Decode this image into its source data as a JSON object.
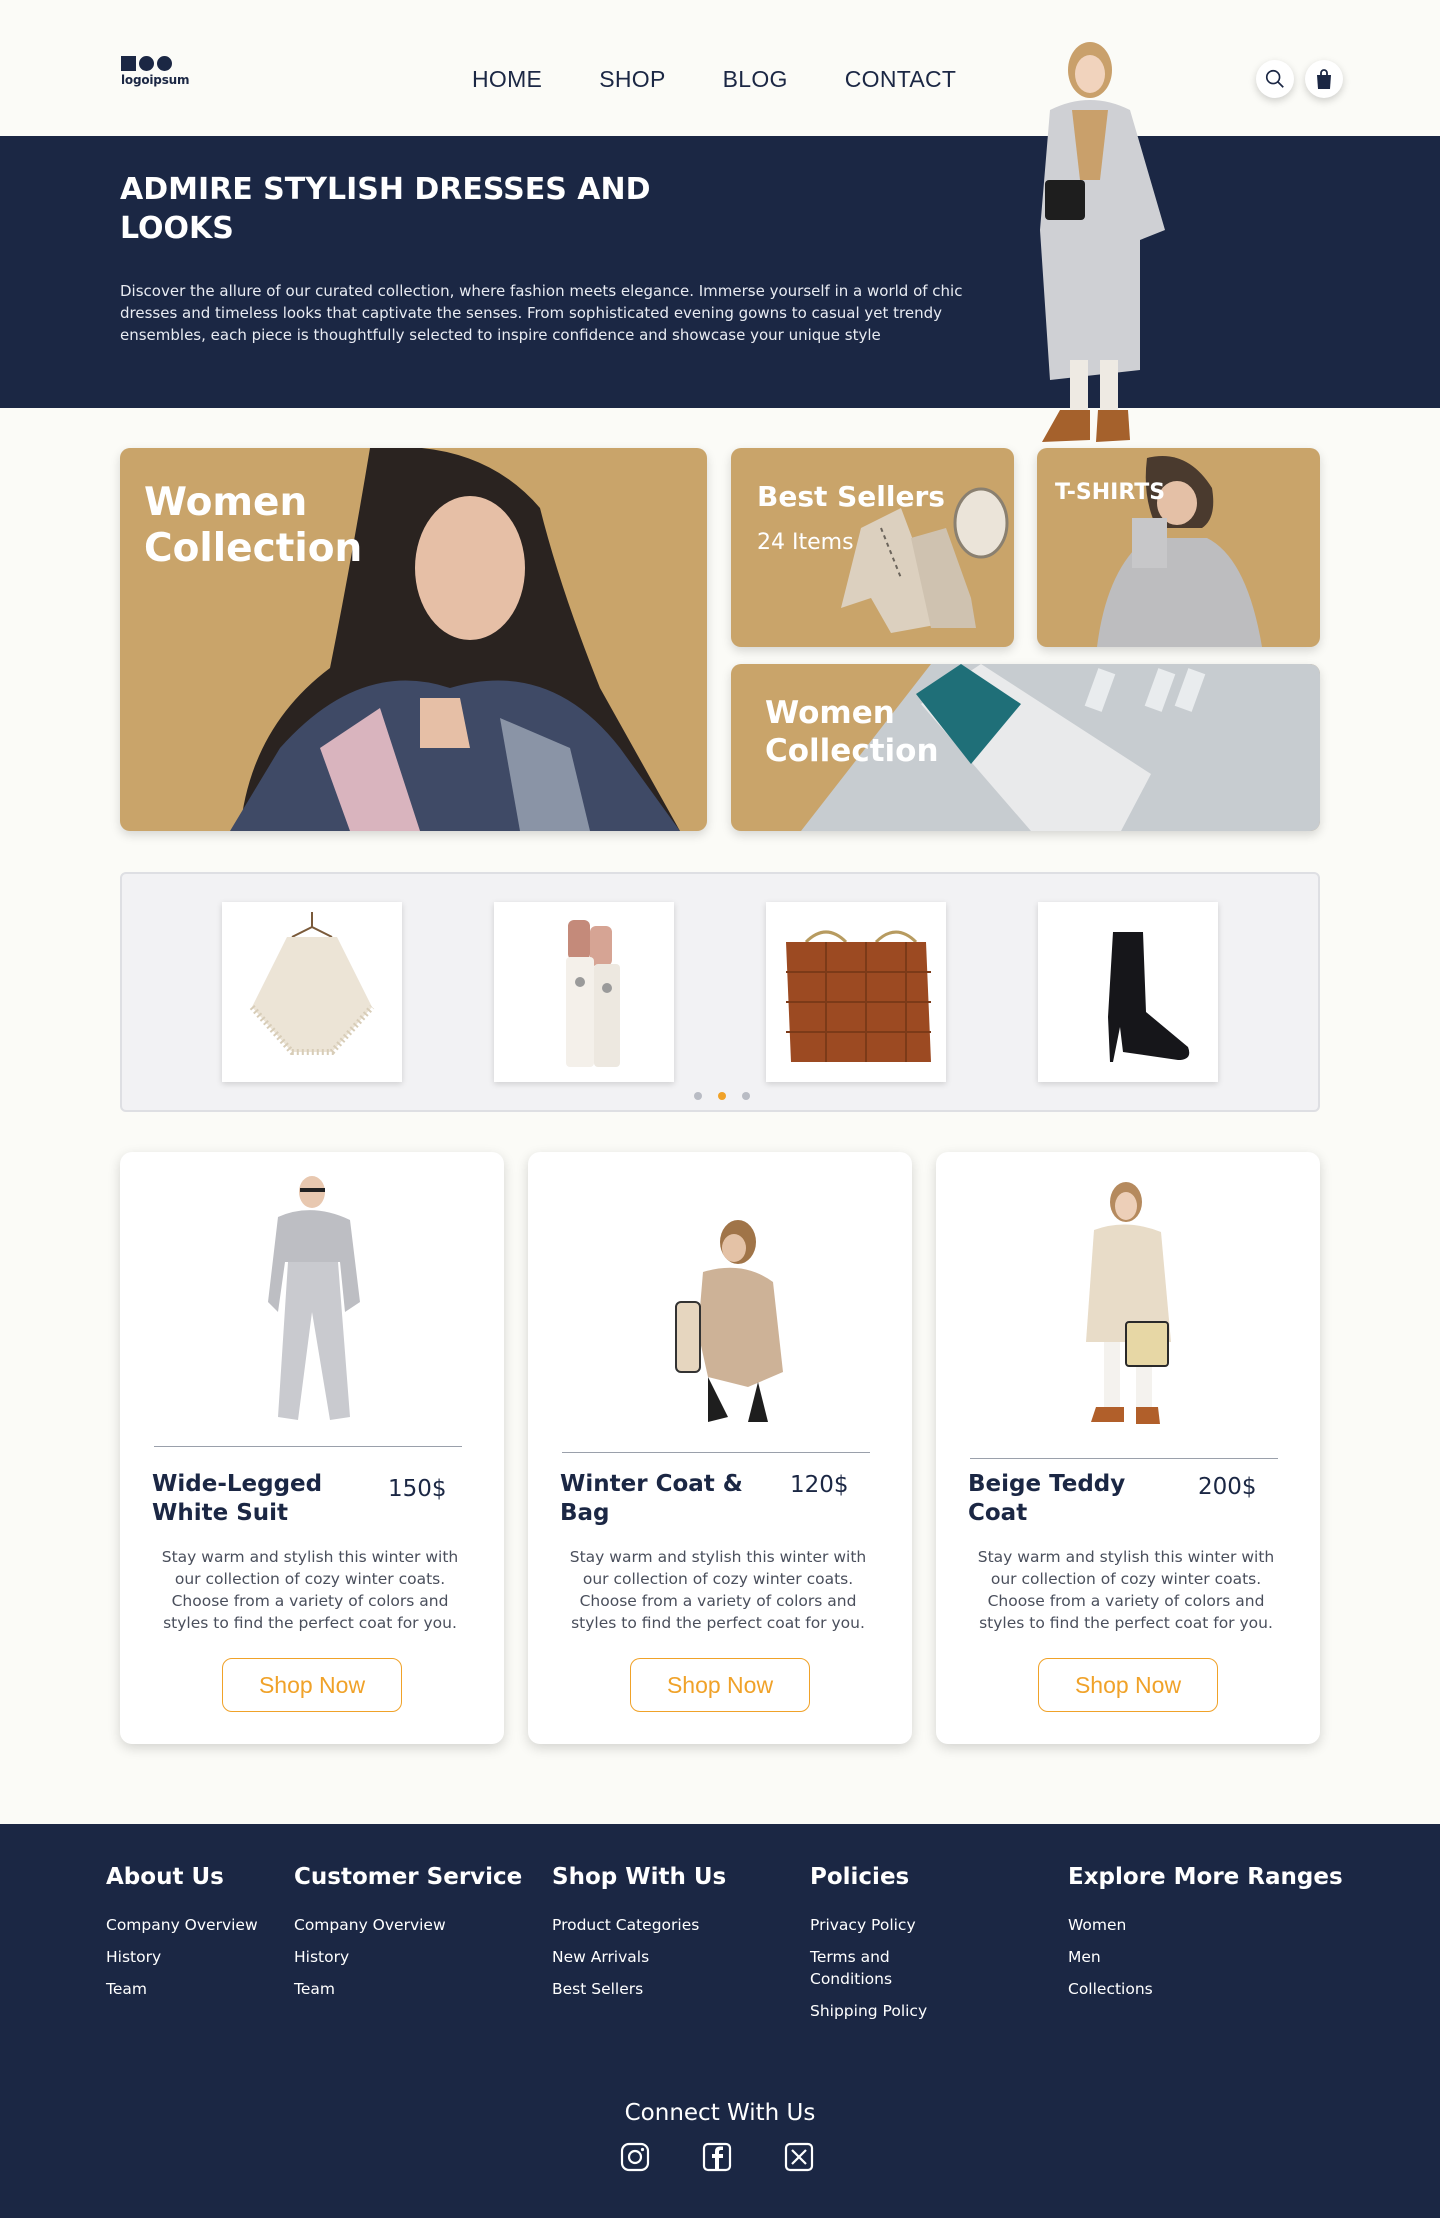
{
  "header": {
    "logo_text": "logoipsum",
    "nav": [
      "HOME",
      "SHOP",
      "BLOG",
      "CONTACT"
    ],
    "search_icon": "search-icon",
    "cart_icon": "shopping-bag-icon"
  },
  "hero": {
    "title": "ADMIRE STYLISH DRESSES AND LOOKS",
    "description": "Discover the allure of our curated collection, where fashion meets elegance. Immerse yourself in a world of chic dresses and timeless looks that captivate the senses. From sophisticated evening gowns to casual yet trendy ensembles, each piece is thoughtfully selected to inspire confidence and showcase your unique style"
  },
  "collections": {
    "women": "Women Collection",
    "best_sellers": "Best Sellers",
    "best_sellers_count": "24 Items",
    "tshirts": "T-SHIRTS",
    "women2": "Women Collection"
  },
  "carousel": {
    "items": [
      "poncho",
      "cosmetic bottles",
      "brown woven bag",
      "black ankle boot"
    ],
    "active_dot": 1
  },
  "products": [
    {
      "name": "Wide-Legged White Suit",
      "price": "150$",
      "description": "Stay warm and stylish this winter with our collection of cozy winter coats. Choose from a variety of colors and styles to find the perfect coat for you.",
      "button": "Shop Now"
    },
    {
      "name": "Winter Coat & Bag",
      "price": "120$",
      "description": "Stay warm and stylish this winter with our collection of cozy winter coats. Choose from a variety of colors and styles to find the perfect coat for you.",
      "button": "Shop Now"
    },
    {
      "name": "Beige Teddy Coat",
      "price": "200$",
      "description": "Stay warm and stylish this winter with our collection of cozy winter coats. Choose from a variety of colors and styles to find the perfect coat for you.",
      "button": "Shop Now"
    }
  ],
  "footer": {
    "columns": [
      {
        "title": "About Us",
        "links": [
          "Company Overview",
          "History",
          "Team"
        ]
      },
      {
        "title": "Customer Service",
        "links": [
          "Company Overview",
          "History",
          "Team"
        ]
      },
      {
        "title": "Shop With Us",
        "links": [
          "Product Categories",
          "New Arrivals",
          "Best Sellers"
        ]
      },
      {
        "title": "Policies",
        "links": [
          "Privacy Policy",
          "Terms and Conditions",
          "Shipping Policy"
        ]
      },
      {
        "title": "Explore More Ranges",
        "links": [
          "Women",
          "Men",
          "Collections"
        ]
      }
    ],
    "connect": "Connect With Us",
    "socials": [
      "instagram-icon",
      "facebook-icon",
      "x-icon"
    ]
  },
  "colors": {
    "navy": "#1b2744",
    "gold": "#c9a46a",
    "accent": "#f0a229",
    "background": "#fbfbf7"
  }
}
